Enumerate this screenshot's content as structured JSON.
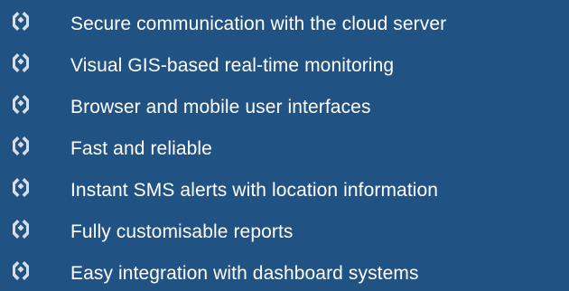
{
  "bullet_icon": "interlocking-link-icon",
  "colors": {
    "background": "#205383",
    "text": "#ffffff",
    "icon": "#d8dde6"
  },
  "features": [
    {
      "text": "Secure communication with the cloud server"
    },
    {
      "text": "Visual GIS-based real-time monitoring"
    },
    {
      "text": "Browser and mobile user interfaces"
    },
    {
      "text": "Fast and reliable"
    },
    {
      "text": "Instant SMS alerts with location information"
    },
    {
      "text": "Fully customisable reports"
    },
    {
      "text": "Easy integration with dashboard systems"
    }
  ]
}
